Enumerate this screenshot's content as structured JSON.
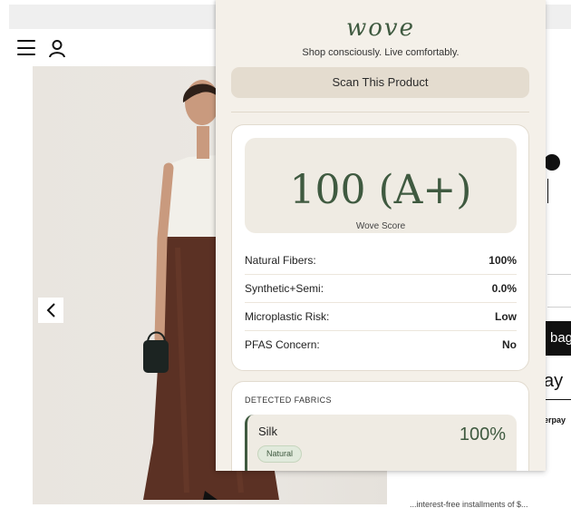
{
  "shop": {
    "bag_label": "bag",
    "pay_label": "ay",
    "afterpay_label": "erpay",
    "footer_fragment": "...interest-free installments of $..."
  },
  "extension": {
    "brand": "wove",
    "tagline": "Shop consciously. Live comfortably.",
    "scan_button": "Scan This Product",
    "score": {
      "value": "100 (A+)",
      "label": "Wove Score"
    },
    "metrics": [
      {
        "label": "Natural Fibers:",
        "value": "100%"
      },
      {
        "label": "Synthetic+Semi:",
        "value": "0.0%"
      },
      {
        "label": "Microplastic Risk:",
        "value": "Low"
      },
      {
        "label": "PFAS Concern:",
        "value": "No"
      }
    ],
    "fabrics": {
      "title": "DETECTED FABRICS",
      "items": [
        {
          "name": "Silk",
          "tag": "Natural",
          "percent": "100%"
        }
      ]
    },
    "accent_color": "#3f5a40"
  }
}
